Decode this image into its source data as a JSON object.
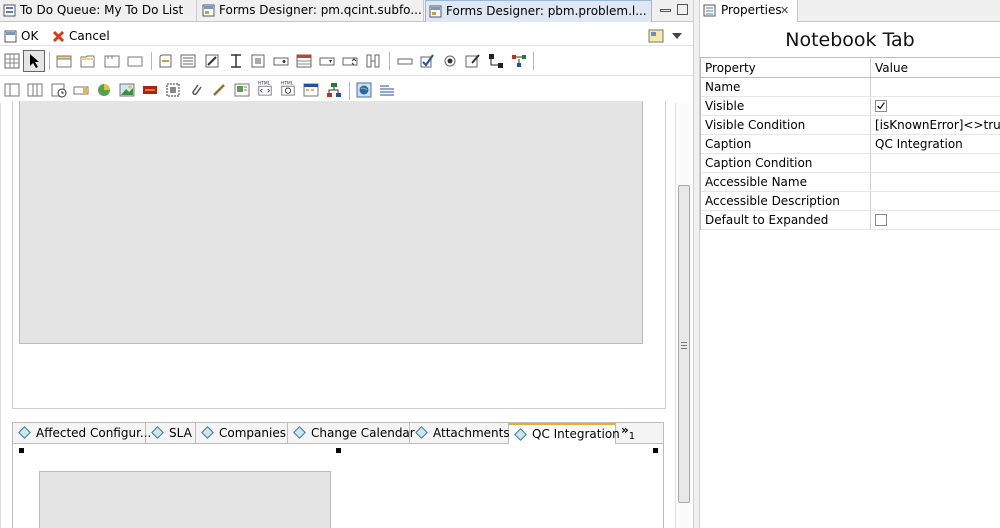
{
  "editor_tabs": [
    {
      "label": "To Do Queue: My To Do List",
      "active": false
    },
    {
      "label": "Forms Designer: pm.qcint.subfo...",
      "active": false
    },
    {
      "label": "Forms Designer: pbm.problem.l...",
      "active": true
    }
  ],
  "actions": {
    "ok_label": "OK",
    "cancel_label": "Cancel"
  },
  "toolbar_row1": [
    "grid-icon",
    "pointer-icon",
    "section-icon",
    "folder-icon",
    "panel-icon",
    "box-icon",
    "group-icon",
    "list-icon",
    "script-icon",
    "textfield-icon",
    "field-icon",
    "button-icon",
    "table-icon",
    "dropdown-icon",
    "spinner-icon",
    "slider-icon",
    "checkbox-icon",
    "radio-icon",
    "edit-icon",
    "tree-icon",
    "network-icon"
  ],
  "toolbar_row2": [
    "column-icon",
    "columns-icon",
    "date-icon",
    "image-field-icon",
    "chart-icon",
    "picture-icon",
    "label-icon",
    "select-icon",
    "attach-icon",
    "link-icon",
    "report-icon",
    "html-icon",
    "html-preview-icon",
    "calendar-icon",
    "org-icon",
    "globe-icon",
    "lines-icon"
  ],
  "notebook_tabs": [
    {
      "label": "Affected Configur...",
      "active": false
    },
    {
      "label": "SLA",
      "active": false
    },
    {
      "label": "Companies",
      "active": false
    },
    {
      "label": "Change Calendar",
      "active": false
    },
    {
      "label": "Attachments",
      "active": false
    },
    {
      "label": "QC Integration",
      "active": true
    }
  ],
  "notebook_overflow": {
    "chevron": "»",
    "count": "1"
  },
  "properties": {
    "tab_label": "Properties",
    "title": "Notebook Tab",
    "col_property": "Property",
    "col_value": "Value",
    "rows": [
      {
        "name": "Name",
        "value": "",
        "type": "text"
      },
      {
        "name": "Visible",
        "value": "true",
        "type": "checkbox",
        "checked": true
      },
      {
        "name": "Visible Condition",
        "value": "[isKnownError]<>true",
        "type": "text"
      },
      {
        "name": "Caption",
        "value": "QC Integration",
        "type": "text"
      },
      {
        "name": "Caption Condition",
        "value": "",
        "type": "text"
      },
      {
        "name": "Accessible Name",
        "value": "",
        "type": "text"
      },
      {
        "name": "Accessible Description",
        "value": "",
        "type": "text"
      },
      {
        "name": "Default to Expanded",
        "value": "false",
        "type": "checkbox",
        "checked": false
      }
    ]
  },
  "colors": {
    "active_tab_accent": "#f0a830",
    "selected_tab_bg": "#dde8f4",
    "form_gray": "#e4e4e4"
  }
}
